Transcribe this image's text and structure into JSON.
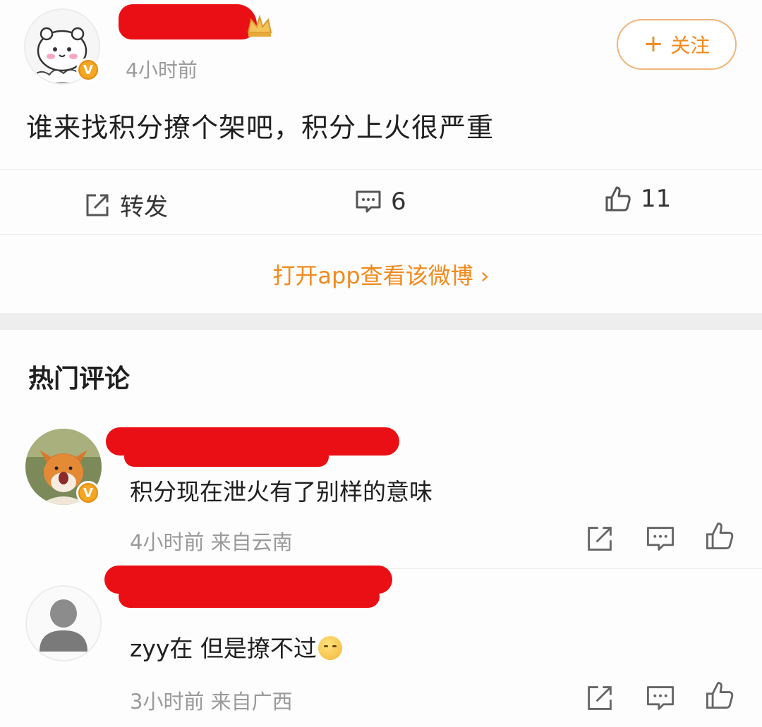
{
  "post": {
    "time": "4小时前",
    "follow_label": "关注",
    "follow_plus": "+",
    "text": "谁来找积分撩个架吧，积分上火很严重",
    "actions": {
      "repost_label": "转发",
      "comment_count": "6",
      "like_count": "11"
    },
    "open_app": "打开app查看该微博 ›"
  },
  "hot_comments": {
    "title": "热门评论",
    "items": [
      {
        "text": "积分现在泄火有了别样的意味",
        "meta": "4小时前 来自云南"
      },
      {
        "text": "zyy在 但是撩不过",
        "meta": "3小时前 来自广西"
      }
    ]
  },
  "colors": {
    "accent": "#f08a1d",
    "redaction": "#ea0f14",
    "verified_badge": "#f5a623"
  }
}
